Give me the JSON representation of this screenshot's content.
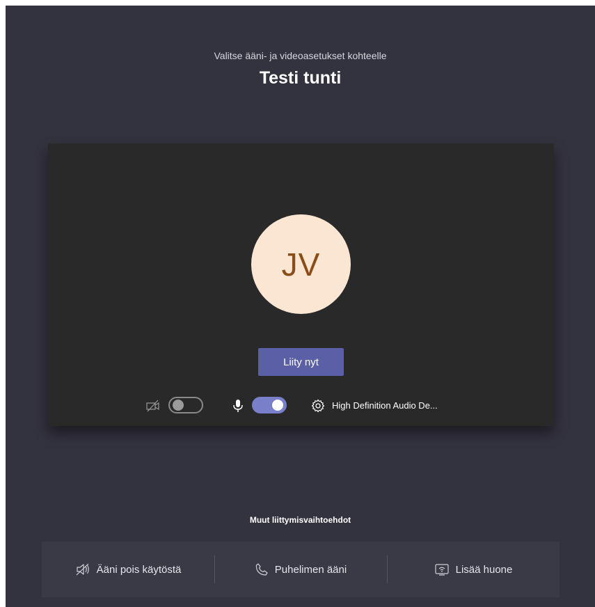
{
  "header": {
    "subtitle": "Valitse ääni- ja videoasetukset kohteelle",
    "meeting_title": "Testi tunti"
  },
  "preview": {
    "avatar_initials": "JV",
    "join_button_label": "Liity nyt",
    "camera_toggle": "off",
    "microphone_toggle": "on",
    "audio_device_label": "High Definition Audio De..."
  },
  "other_options": {
    "heading": "Muut liittymisvaihtoehdot",
    "items": [
      {
        "label": "Ääni pois käytöstä",
        "icon": "speaker-off-icon"
      },
      {
        "label": "Puhelimen ääni",
        "icon": "phone-icon"
      },
      {
        "label": "Lisää huone",
        "icon": "room-cast-icon"
      }
    ]
  },
  "colors": {
    "background": "#33323f",
    "preview_background": "#292929",
    "accent": "#5b5fa5",
    "toggle_on": "#7a7fc9",
    "avatar_background": "#fae6d3",
    "avatar_text": "#8a4d18"
  }
}
